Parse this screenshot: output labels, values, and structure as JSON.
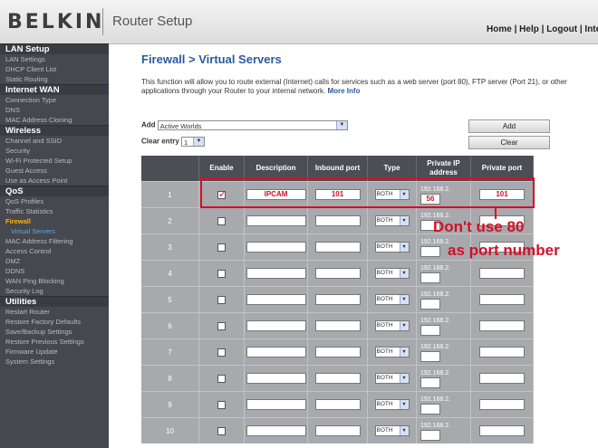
{
  "header": {
    "logo": "BELKIN",
    "app_title": "Router Setup",
    "links": {
      "home": "Home",
      "help": "Help",
      "logout": "Logout",
      "internet": "Interne",
      "sep": " | "
    }
  },
  "sidebar": [
    {
      "label": "LAN Setup",
      "kind": "group"
    },
    {
      "label": "LAN Settings",
      "kind": "item"
    },
    {
      "label": "DHCP Client List",
      "kind": "item"
    },
    {
      "label": "Static Routing",
      "kind": "item"
    },
    {
      "label": "Internet WAN",
      "kind": "group"
    },
    {
      "label": "Connection Type",
      "kind": "item"
    },
    {
      "label": "DNS",
      "kind": "item"
    },
    {
      "label": "MAC Address Cloning",
      "kind": "item"
    },
    {
      "label": "Wireless",
      "kind": "group"
    },
    {
      "label": "Channel and SSID",
      "kind": "item"
    },
    {
      "label": "Security",
      "kind": "item"
    },
    {
      "label": "Wi-Fi Protected Setup",
      "kind": "item"
    },
    {
      "label": "Guest Access",
      "kind": "item"
    },
    {
      "label": "Use as Access Point",
      "kind": "item"
    },
    {
      "label": "QoS",
      "kind": "group"
    },
    {
      "label": "QoS Profiles",
      "kind": "item"
    },
    {
      "label": "Traffic Statistics",
      "kind": "item"
    },
    {
      "label": "Firewall",
      "kind": "active"
    },
    {
      "label": "Virtual Servers",
      "kind": "sub"
    },
    {
      "label": "MAC Address Filtering",
      "kind": "item"
    },
    {
      "label": "Access Control",
      "kind": "item"
    },
    {
      "label": "DMZ",
      "kind": "item"
    },
    {
      "label": "DDNS",
      "kind": "item"
    },
    {
      "label": "WAN Ping Blocking",
      "kind": "item"
    },
    {
      "label": "Security Log",
      "kind": "item"
    },
    {
      "label": "Utilities",
      "kind": "group"
    },
    {
      "label": "Restart Router",
      "kind": "item"
    },
    {
      "label": "Restore Factory Defaults",
      "kind": "item"
    },
    {
      "label": "Save/Backup Settings",
      "kind": "item"
    },
    {
      "label": "Restore Previous Settings",
      "kind": "item"
    },
    {
      "label": "Firmware Update",
      "kind": "item"
    },
    {
      "label": "System Settings",
      "kind": "item"
    }
  ],
  "main": {
    "title": "Firewall > Virtual Servers",
    "description": "This function will allow you to route external (Internet) calls for services such as a web server (port 80), FTP server (Port 21), or other applications through your Router to your internal network.",
    "more_info": "More Info",
    "add_label": "Add",
    "add_select_value": "Active Worlds",
    "clear_label": "Clear entry",
    "clear_select_value": "1",
    "add_button": "Add",
    "clear_button": "Clear",
    "table": {
      "headers": [
        "",
        "Enable",
        "Description",
        "Inbound port",
        "Type",
        "Private IP address",
        "Private port"
      ],
      "ip_prefix": "192.168.2.",
      "rows": [
        {
          "num": "1",
          "enabled": true,
          "description": "IPCAM",
          "inbound": "101",
          "type": "BOTH",
          "ip_last": "56",
          "private_port": "101"
        },
        {
          "num": "2",
          "enabled": false,
          "description": "",
          "inbound": "",
          "type": "BOTH",
          "ip_last": "",
          "private_port": ""
        },
        {
          "num": "3",
          "enabled": false,
          "description": "",
          "inbound": "",
          "type": "BOTH",
          "ip_last": "",
          "private_port": ""
        },
        {
          "num": "4",
          "enabled": false,
          "description": "",
          "inbound": "",
          "type": "BOTH",
          "ip_last": "",
          "private_port": ""
        },
        {
          "num": "5",
          "enabled": false,
          "description": "",
          "inbound": "",
          "type": "BOTH",
          "ip_last": "",
          "private_port": ""
        },
        {
          "num": "6",
          "enabled": false,
          "description": "",
          "inbound": "",
          "type": "BOTH",
          "ip_last": "",
          "private_port": ""
        },
        {
          "num": "7",
          "enabled": false,
          "description": "",
          "inbound": "",
          "type": "BOTH",
          "ip_last": "",
          "private_port": ""
        },
        {
          "num": "8",
          "enabled": false,
          "description": "",
          "inbound": "",
          "type": "BOTH",
          "ip_last": "",
          "private_port": ""
        },
        {
          "num": "9",
          "enabled": false,
          "description": "",
          "inbound": "",
          "type": "BOTH",
          "ip_last": "",
          "private_port": ""
        },
        {
          "num": "10",
          "enabled": false,
          "description": "",
          "inbound": "",
          "type": "BOTH",
          "ip_last": "",
          "private_port": ""
        }
      ]
    }
  },
  "annotation": {
    "line1": "Don't use 80",
    "line2": "as port number",
    "color": "#d50f25"
  }
}
